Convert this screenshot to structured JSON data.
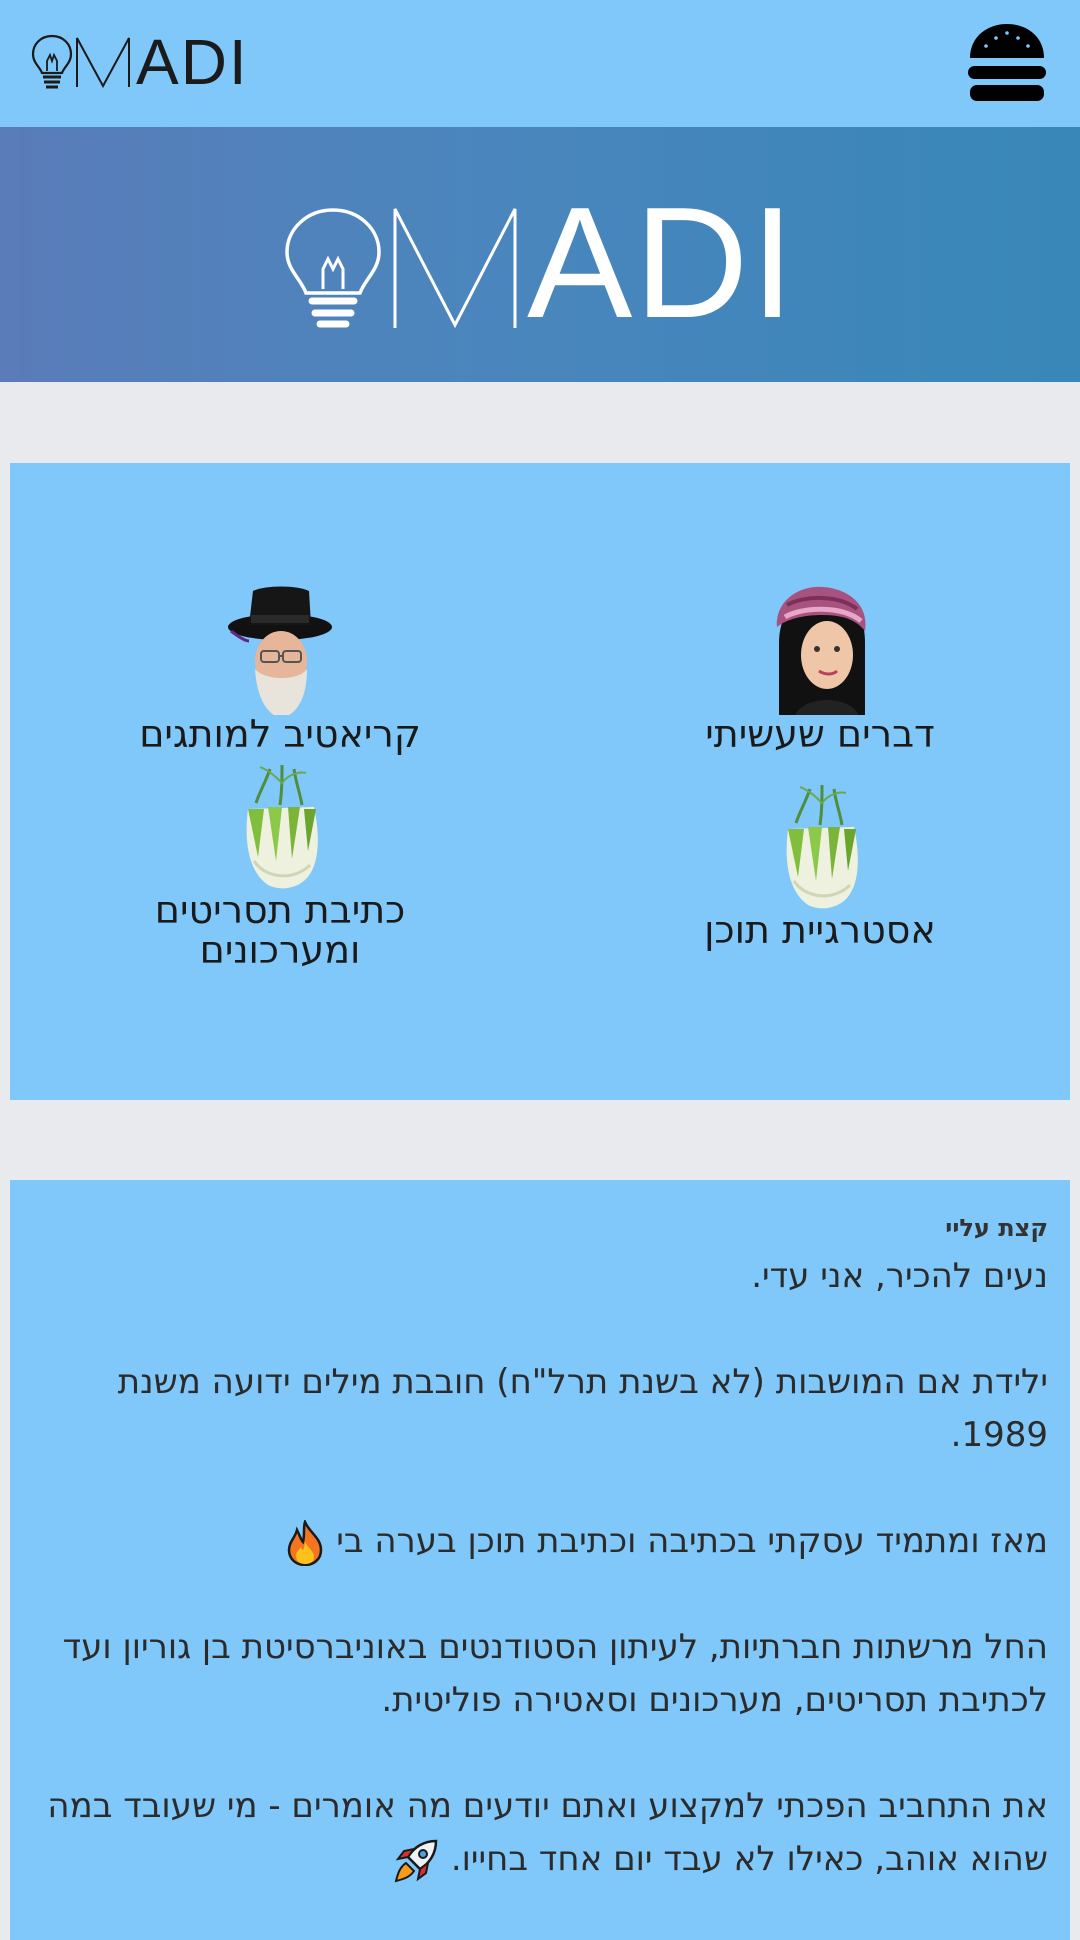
{
  "header": {
    "logo_text": "ADI",
    "menu_icon": "hamburger-icon"
  },
  "hero": {
    "logo_text": "ADI"
  },
  "services": {
    "items": [
      {
        "label": "דברים שעשיתי",
        "icon": "woman-portrait"
      },
      {
        "label": "קריאטיב למותגים",
        "icon": "rabbi-portrait"
      },
      {
        "label": "אסטרגיית תוכן",
        "icon": "fennel-icon"
      },
      {
        "label": "כתיבת תסריטים ומערכונים",
        "icon": "fennel-icon"
      }
    ]
  },
  "about": {
    "heading": "קצת עליי",
    "paragraphs": [
      "נעים להכיר, אני עדי.",
      "ילידת אם המושבות (לא בשנת תרל\"ח) חובבת מילים ידועה משנת 1989.",
      "מאז ומתמיד עסקתי בכתיבה וכתיבת תוכן בערה בי",
      "החל מרשתות חברתיות, לעיתון הסטודנטים באוניברסיטת בן גוריון ועד לכתיבת תסריטים, מערכונים וסאטירה פוליטית.",
      "את התחביב הפכתי למקצוע ואתם יודעים מה אומרים - מי שעובד במה שהוא אוהב, כאילו לא עבד יום אחד בחייו."
    ],
    "emojis": [
      "fire-icon",
      "rocket-icon"
    ]
  }
}
